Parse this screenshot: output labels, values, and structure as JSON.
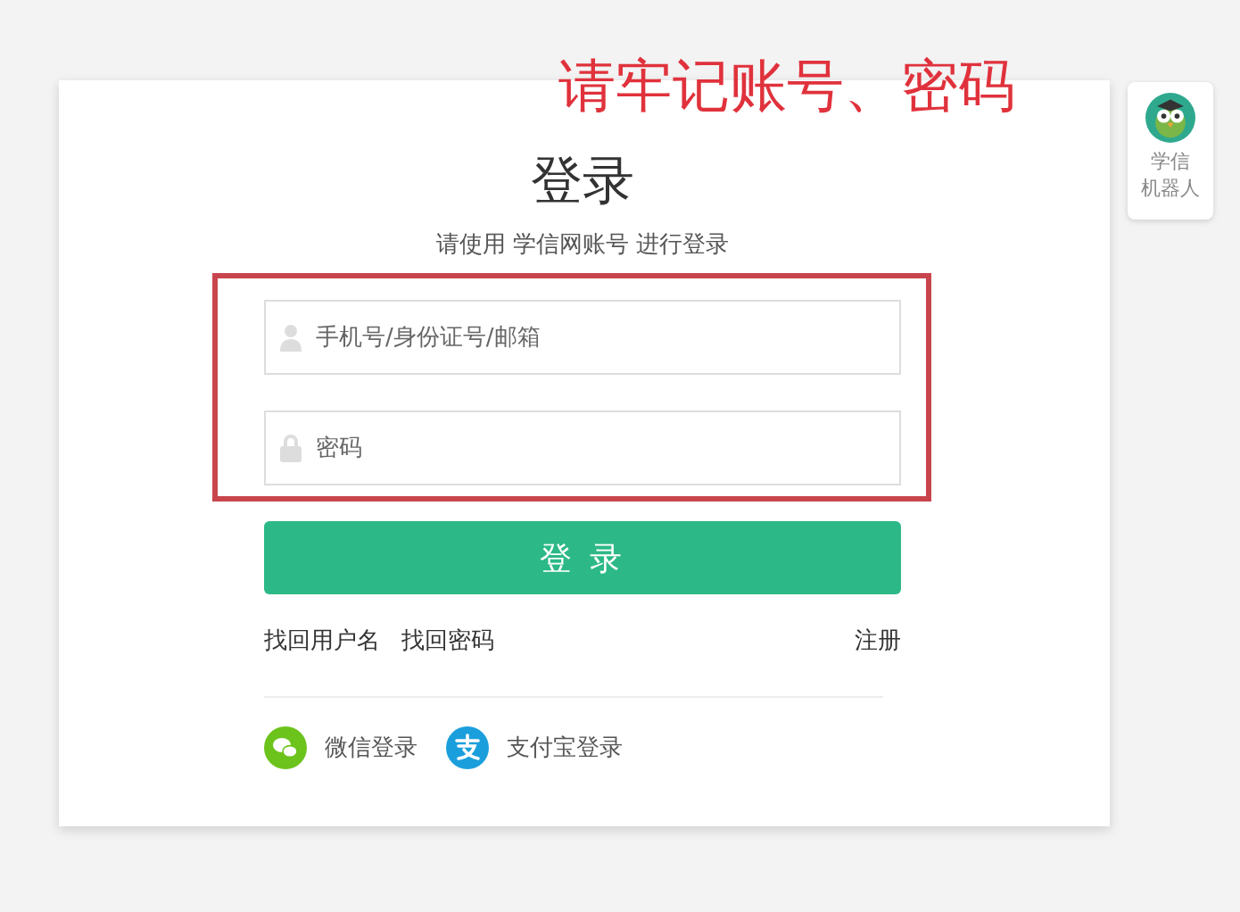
{
  "annotation": "请牢记账号、密码",
  "login": {
    "title": "登录",
    "subtitle": "请使用 学信网账号 进行登录",
    "fields": [
      {
        "kind": "user",
        "placeholder": "手机号/身份证号/邮箱"
      },
      {
        "kind": "lock",
        "placeholder": "密码"
      }
    ],
    "submit": "登 录",
    "links": [
      "找回用户名",
      "找回密码"
    ],
    "register": "注册",
    "social": [
      {
        "kind": "wechat",
        "label": "微信登录",
        "color": "#6cc31c"
      },
      {
        "kind": "alipay",
        "label": "支付宝登录",
        "color": "#1b9fdc"
      }
    ]
  },
  "robot": {
    "lines": [
      "学信",
      "机器人"
    ]
  }
}
